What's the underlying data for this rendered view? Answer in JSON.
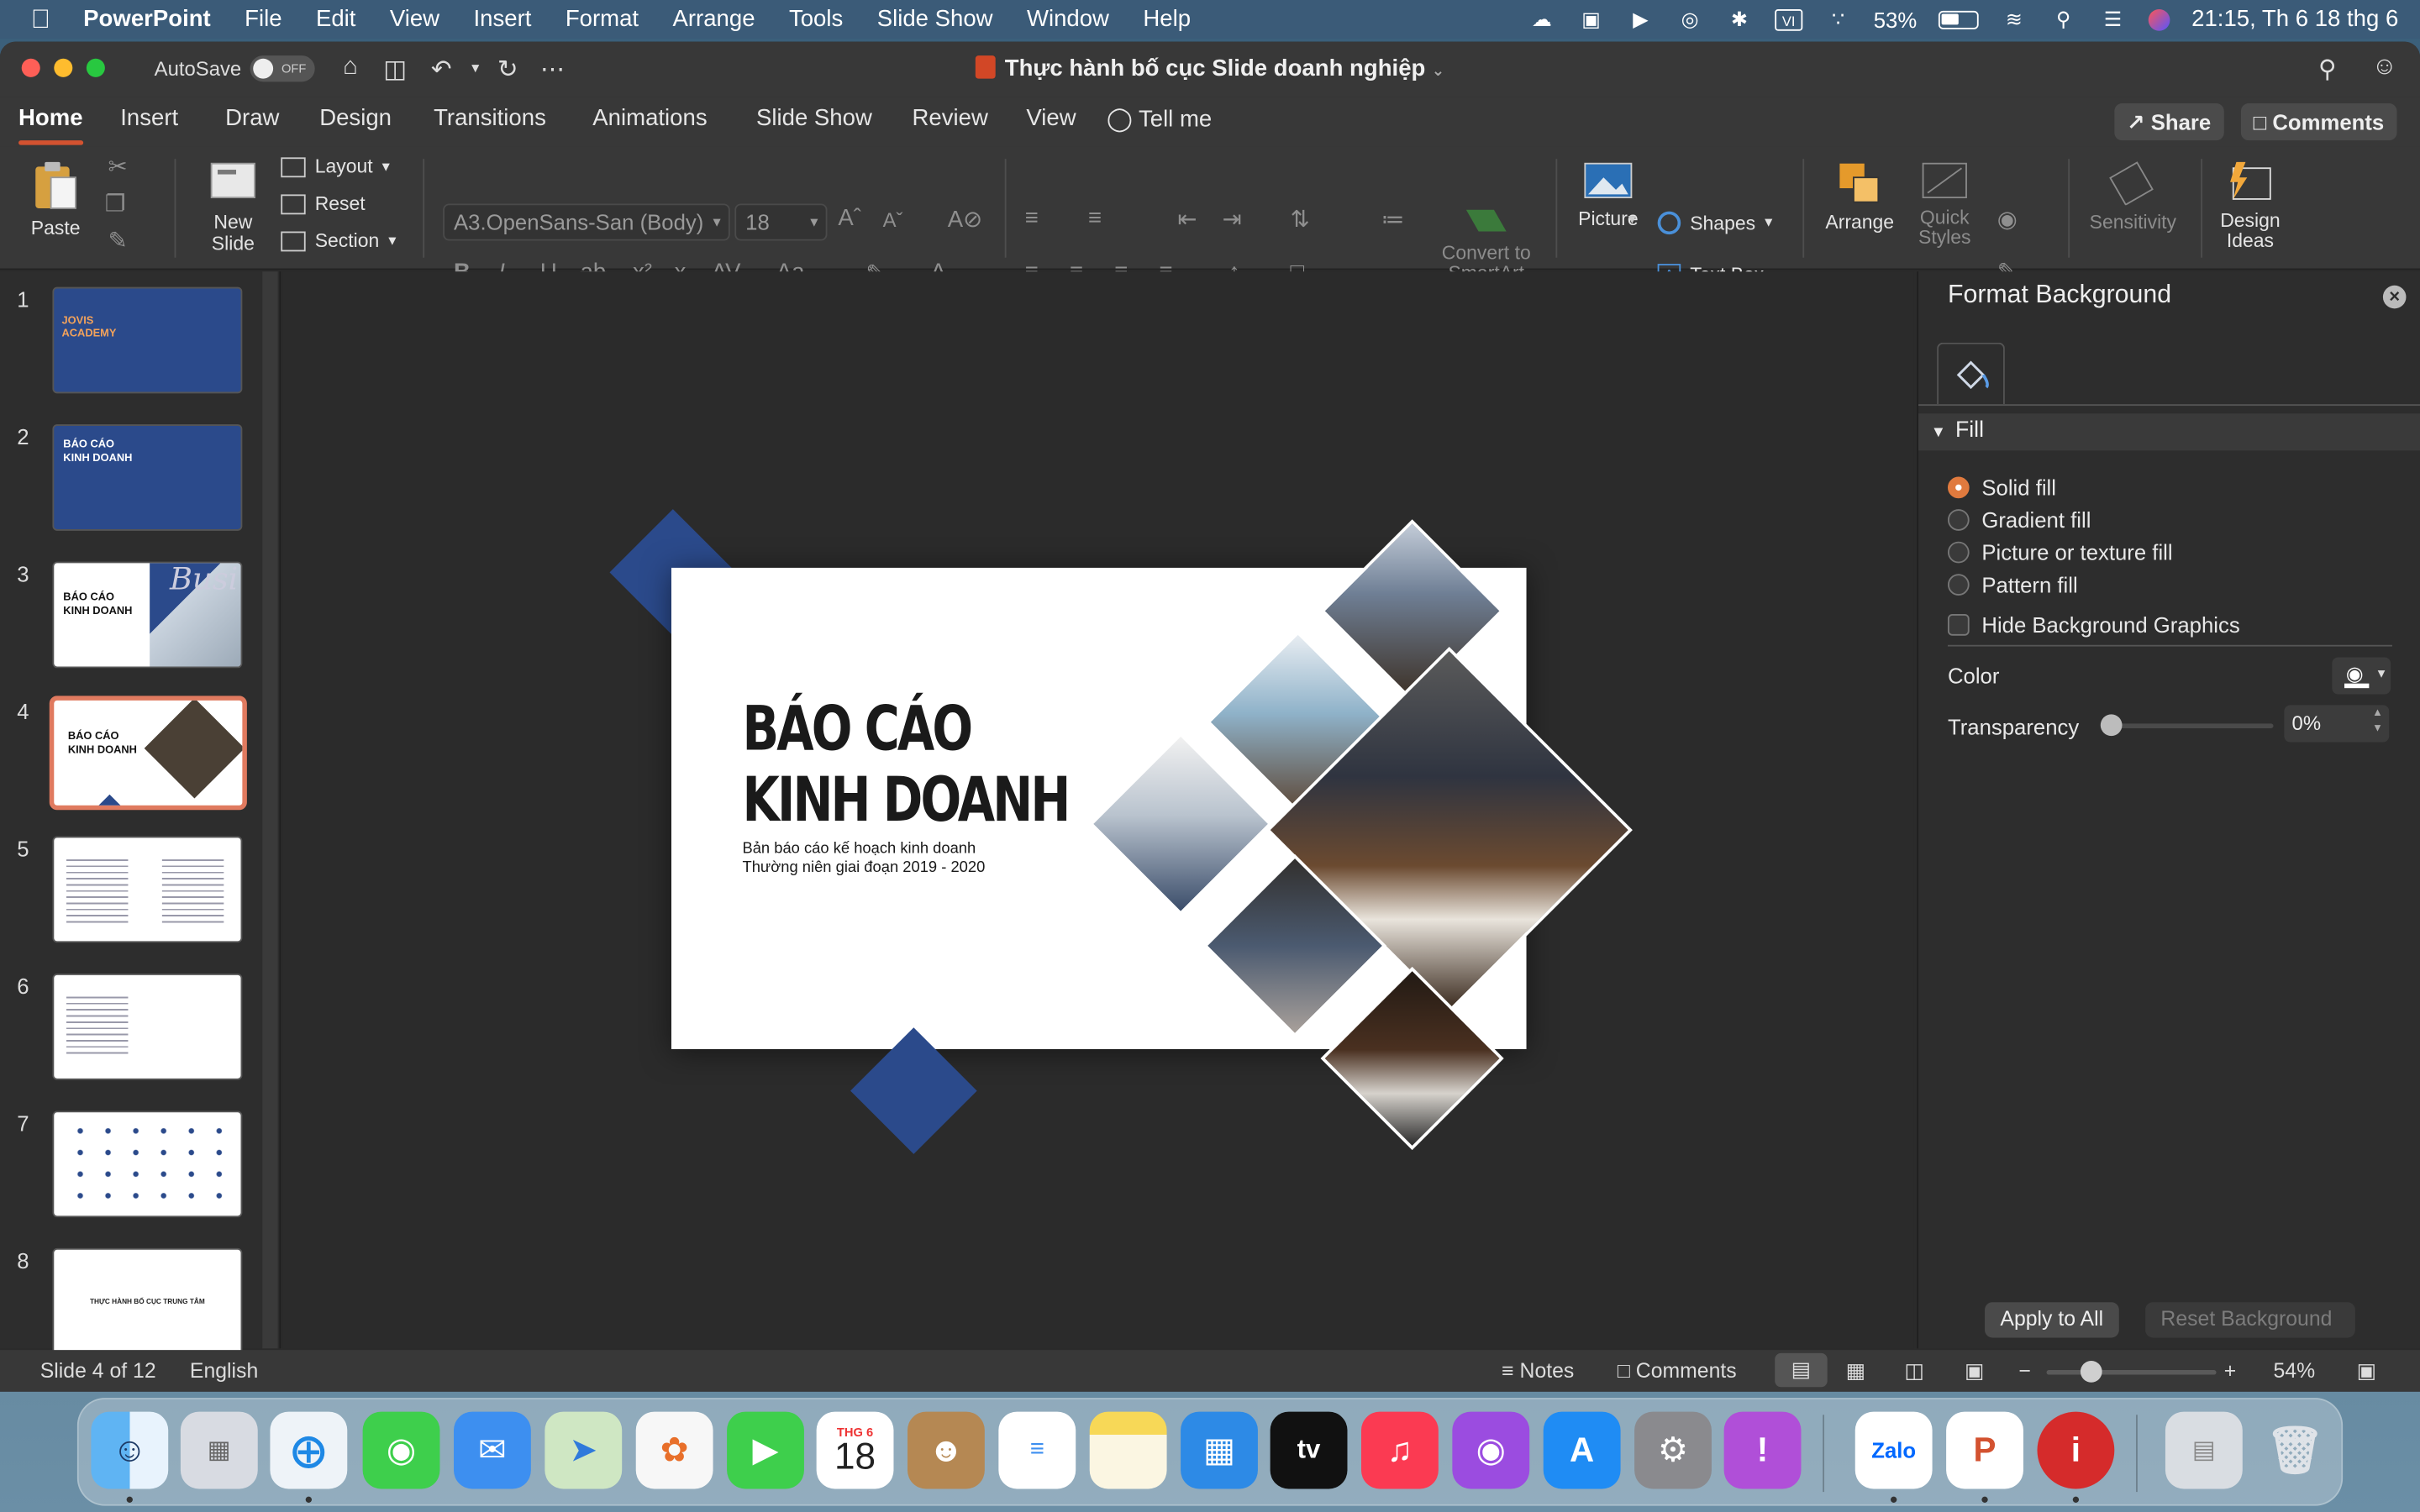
{
  "menubar": {
    "app": "PowerPoint",
    "items": [
      "File",
      "Edit",
      "View",
      "Insert",
      "Format",
      "Arrange",
      "Tools",
      "Slide Show",
      "Window",
      "Help"
    ],
    "battery": "53%",
    "battery_level": 0.53,
    "clock": "21:15, Th 6 18 thg 6"
  },
  "titlebar": {
    "autosave_label": "AutoSave",
    "autosave_state": "OFF",
    "document_title": "Thực hành bố cục Slide doanh nghiệp"
  },
  "ribbon_tabs": [
    "Home",
    "Insert",
    "Draw",
    "Design",
    "Transitions",
    "Animations",
    "Slide Show",
    "Review",
    "View"
  ],
  "active_tab": "Home",
  "tell_me": "Tell me",
  "share_label": "Share",
  "comments_label": "Comments",
  "ribbon": {
    "paste": "Paste",
    "new_slide": "New Slide",
    "new_slide_l1": "New",
    "new_slide_l2": "Slide",
    "layout": "Layout",
    "reset": "Reset",
    "section": "Section",
    "font_name": "A3.OpenSans-San (Body)",
    "font_size": "18",
    "convert_smartart_l1": "Convert to",
    "convert_smartart_l2": "SmartArt",
    "picture": "Picture",
    "shapes": "Shapes",
    "text_box": "Text Box",
    "arrange": "Arrange",
    "quick_styles_l1": "Quick",
    "quick_styles_l2": "Styles",
    "sensitivity": "Sensitivity",
    "design_ideas_l1": "Design",
    "design_ideas_l2": "Ideas"
  },
  "thumbnails": [
    {
      "num": "1",
      "title": "JOVIS ACADEMY"
    },
    {
      "num": "2",
      "title": "BÁO CÁO KINH DOANH"
    },
    {
      "num": "3",
      "title": "BÁO CÁO KINH DOANH",
      "watermark": "Busi"
    },
    {
      "num": "4",
      "title": "BÁO CÁO KINH DOANH"
    },
    {
      "num": "5"
    },
    {
      "num": "6"
    },
    {
      "num": "7"
    },
    {
      "num": "8",
      "title": "THỰC HÀNH BỐ CỤC TRUNG TÂM"
    }
  ],
  "selected_slide": 4,
  "slide": {
    "title_line1": "BÁO CÁO",
    "title_line2": "KINH DOANH",
    "subtitle_line1": "Bản báo cáo kế hoạch kinh doanh",
    "subtitle_line2": "Thường niên giai đoạn 2019 - 2020",
    "accent": "#2b4a8b"
  },
  "format_background": {
    "title": "Format Background",
    "section": "Fill",
    "options": [
      "Solid fill",
      "Gradient fill",
      "Picture or texture fill",
      "Pattern fill"
    ],
    "selected_option": "Solid fill",
    "hide_graphics": "Hide Background Graphics",
    "color_label": "Color",
    "transparency_label": "Transparency",
    "transparency_value": "0%",
    "apply_all": "Apply to All",
    "reset_bg": "Reset Background"
  },
  "statusbar": {
    "slide_indicator": "Slide 4 of 12",
    "language": "English",
    "notes": "Notes",
    "comments": "Comments",
    "zoom": "54%"
  },
  "dock": {
    "calendar_month": "THG 6",
    "calendar_day": "18",
    "apps": [
      "Finder",
      "Launchpad",
      "Safari",
      "Messages",
      "Mail",
      "Maps",
      "Photos",
      "FaceTime",
      "Calendar",
      "Contacts",
      "Reminders",
      "Notes",
      "Windows App",
      "Apple TV",
      "Music",
      "Podcasts",
      "App Store",
      "System Settings",
      "Feedback",
      "Zalo",
      "PowerPoint",
      "Info",
      "Downloads",
      "Trash"
    ],
    "zalo_label": "Zalo",
    "appletv_label": "tv"
  }
}
